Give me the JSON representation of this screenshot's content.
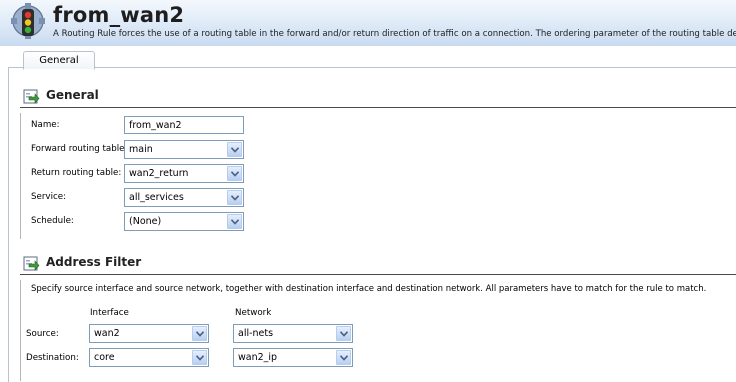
{
  "header": {
    "title": "from_wan2",
    "description": "A Routing Rule forces the use of a routing table in the forward and/or return direction of traffic on a connection. The ordering parameter of the routing table determi",
    "icon": "traffic-light-gear-icon"
  },
  "tabs": [
    {
      "label": "General",
      "active": true
    }
  ],
  "general": {
    "title": "General",
    "icon": "edit-arrow-icon",
    "fields": {
      "name": {
        "label": "Name:",
        "value": "from_wan2"
      },
      "forward": {
        "label": "Forward routing table:",
        "value": "main"
      },
      "return": {
        "label": "Return routing table:",
        "value": "wan2_return"
      },
      "service": {
        "label": "Service:",
        "value": "all_services"
      },
      "schedule": {
        "label": "Schedule:",
        "value": "(None)"
      }
    }
  },
  "address_filter": {
    "title": "Address Filter",
    "icon": "edit-arrow-icon",
    "description": "Specify source interface and source network, together with destination interface and destination network. All parameters have to match for the rule to match.",
    "columns": {
      "interface": "Interface",
      "network": "Network"
    },
    "rows": {
      "source": {
        "label": "Source:",
        "interface": "wan2",
        "network": "all-nets"
      },
      "destination": {
        "label": "Destination:",
        "interface": "core",
        "network": "wan2_ip"
      }
    }
  },
  "colors": {
    "header_gradient_top": "#f4f8fd",
    "header_gradient_bottom": "#c9daf0",
    "input_border": "#7f9db9",
    "dropdown_button": "#b8cff3"
  }
}
